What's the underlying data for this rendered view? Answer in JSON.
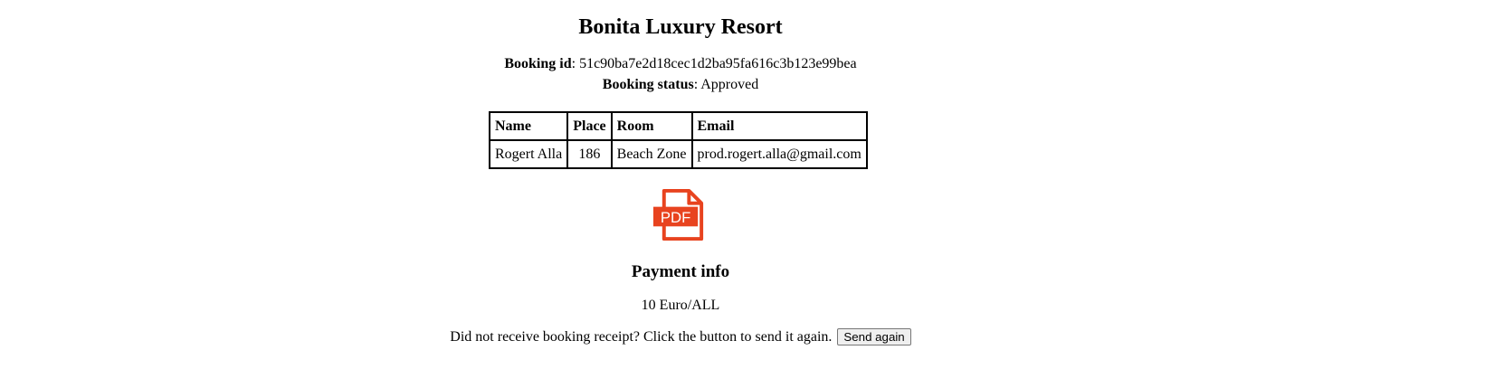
{
  "header": {
    "title": "Bonita Luxury Resort"
  },
  "booking": {
    "id_label": "Booking id",
    "id_value": "51c90ba7e2d18cec1d2ba95fa616c3b123e99bea",
    "status_label": "Booking status",
    "status_value": "Approved"
  },
  "table": {
    "headers": [
      "Name",
      "Place",
      "Room",
      "Email"
    ],
    "rows": [
      [
        "Rogert Alla",
        "186",
        "Beach Zone",
        "prod.rogert.alla@gmail.com"
      ]
    ]
  },
  "pdf": {
    "icon": "pdf-icon",
    "label": "PDF",
    "color": "#e8431f"
  },
  "payment": {
    "heading": "Payment info",
    "amount": "10 Euro/ALL"
  },
  "resend": {
    "text": "Did not receive booking receipt? Click the button to send it again.",
    "button_label": "Send again"
  }
}
